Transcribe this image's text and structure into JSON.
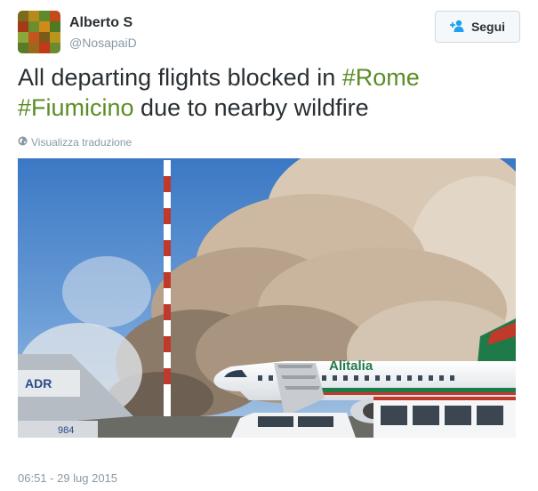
{
  "user": {
    "name": "Alberto S",
    "handle": "@NosapaiD"
  },
  "follow_button": {
    "label": "Segui"
  },
  "tweet": {
    "text_parts": {
      "p1": "All departing flights blocked in ",
      "hashtag1": "#Rome",
      "hashtag2": "#Fiumicino",
      "p2": " due to nearby wildfire"
    },
    "translate_label": "Visualizza traduzione",
    "timestamp": "06:51 - 29 lug 2015"
  },
  "photo": {
    "airline_text": "Alitalia",
    "stair_sign": "ADR",
    "stair_number": "984"
  },
  "colors": {
    "hashtag": "#5b8d27",
    "muted": "#8899a6",
    "text": "#292f33",
    "follow_icon": "#1da1f2"
  }
}
